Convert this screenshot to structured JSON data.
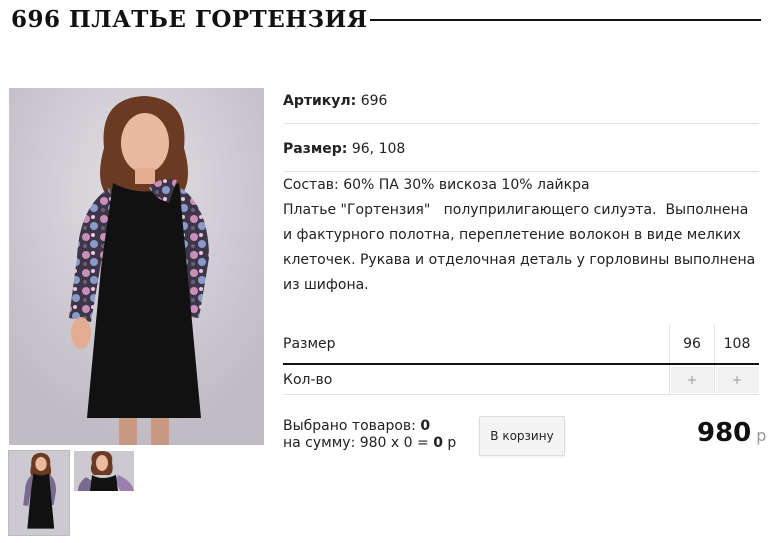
{
  "product": {
    "title": "696 ПЛАТЬЕ ГОРТЕНЗИЯ",
    "article_label": "Артикул:",
    "article_value": "696",
    "size_label": "Размер:",
    "size_value": "96, 108",
    "description": [
      "Состав: 60% ПА 30% вискоза 10% лайкра",
      "Платье \"Гортензия\"   полуприлигающего силуэта.  Выполнена",
      "и фактурного полотна, переплетение волокон в виде мелких",
      "клеточек. Рукава и отделочная деталь у горловины выполнена",
      "из шифона."
    ]
  },
  "size_table": {
    "size_header": "Размер",
    "qty_label": "Кол-во",
    "sizes": [
      "96",
      "108"
    ],
    "plus": "+"
  },
  "summary": {
    "selected_label": "Выбрано товаров:",
    "selected_count": "0",
    "sum_label": "на сумму: 980 х 0 =",
    "sum_value": "0",
    "sum_currency": "р"
  },
  "cart_button": "В корзину",
  "price": {
    "value": "980",
    "currency": "р"
  }
}
